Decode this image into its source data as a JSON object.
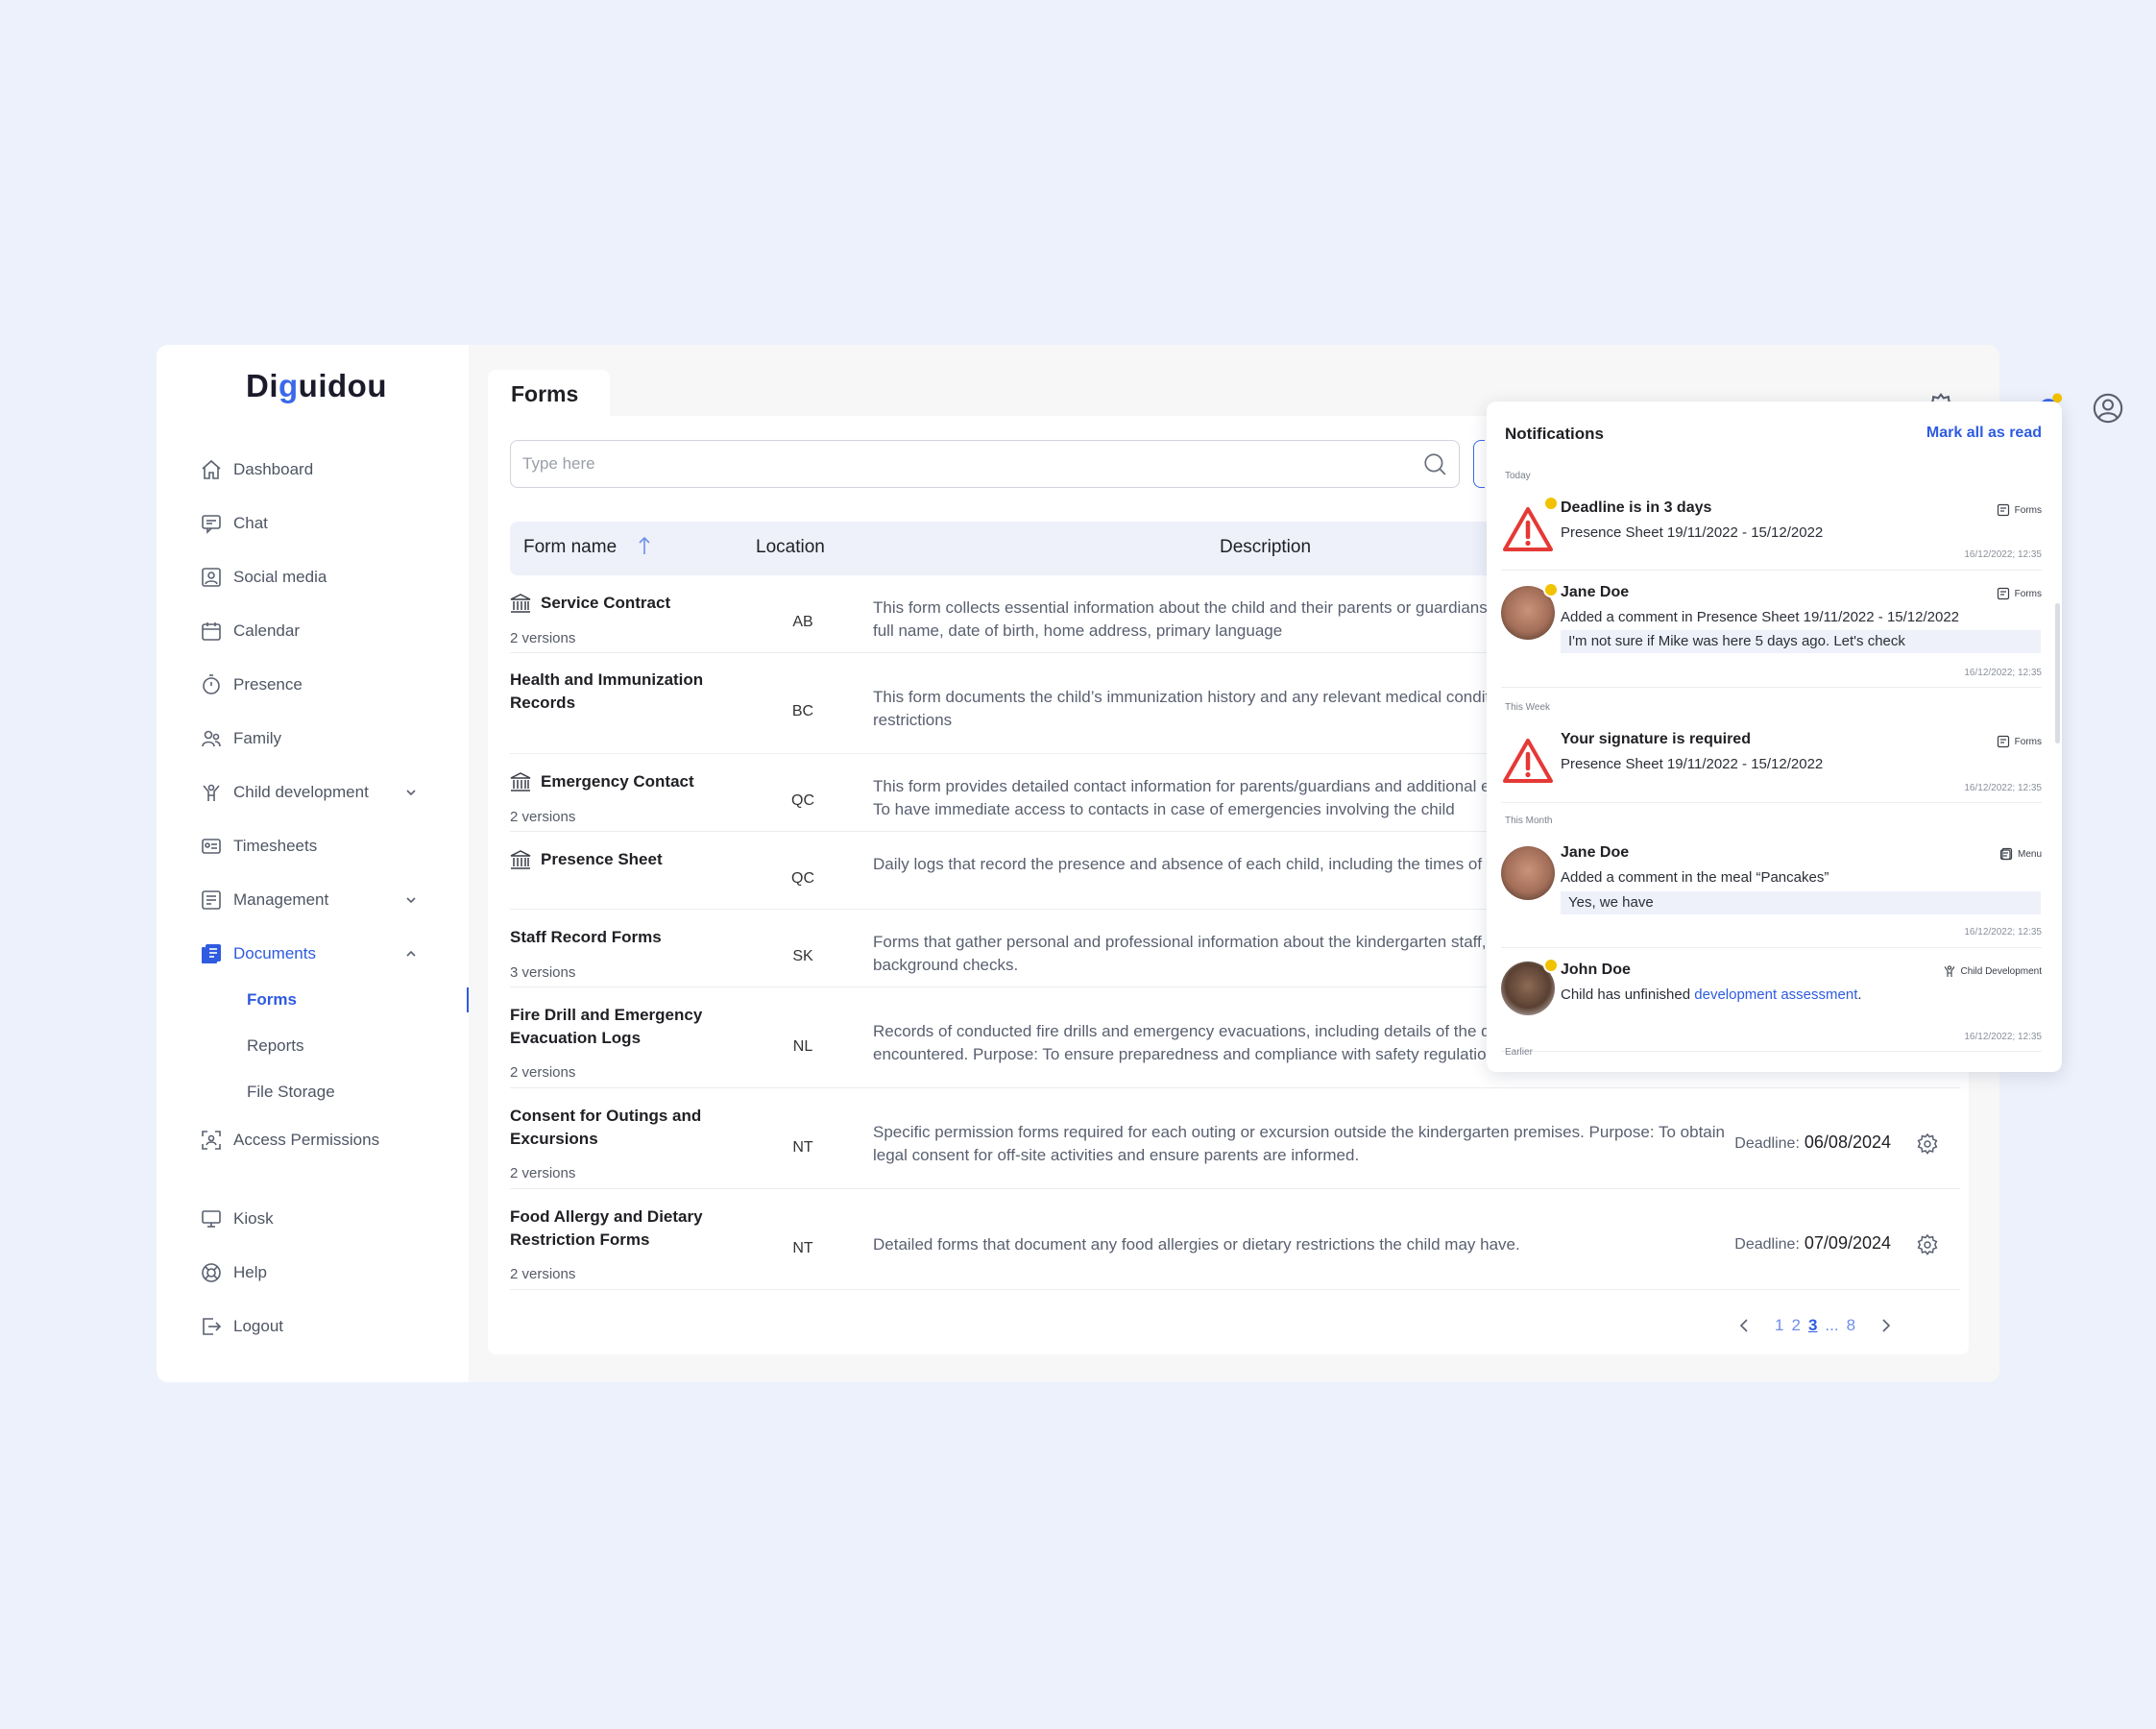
{
  "brand": {
    "logo_pre": "Di",
    "logo_g": "g",
    "logo_post": "uidou"
  },
  "sidebar": {
    "items": [
      {
        "label": "Dashboard"
      },
      {
        "label": "Chat"
      },
      {
        "label": "Social media"
      },
      {
        "label": "Calendar"
      },
      {
        "label": "Presence"
      },
      {
        "label": "Family"
      },
      {
        "label": "Child development"
      },
      {
        "label": "Timesheets"
      },
      {
        "label": "Management"
      },
      {
        "label": "Documents"
      },
      {
        "label": "Access Permissions"
      },
      {
        "label": "Kiosk"
      },
      {
        "label": "Help"
      },
      {
        "label": "Logout"
      }
    ],
    "documents_sub": [
      {
        "label": "Forms"
      },
      {
        "label": "Reports"
      },
      {
        "label": "File Storage"
      }
    ]
  },
  "page": {
    "title": "Forms"
  },
  "search": {
    "placeholder": "Type here"
  },
  "table": {
    "headers": {
      "name": "Form name",
      "location": "Location",
      "description": "Description"
    },
    "rows": [
      {
        "name": "Service Contract",
        "versions": "2 versions",
        "location": "AB",
        "description": "This form collects essential information about the child and their parents or guardians. It typically includes the child's full name, date of birth, home address, primary language",
        "deadline_label": "",
        "deadline": ""
      },
      {
        "name": "Health and Immunization Records",
        "versions": "",
        "location": "BC",
        "description": "This form documents the child’s immunization history and any relevant medical conditions, allergies or dietary restrictions",
        "deadline_label": "",
        "deadline": ""
      },
      {
        "name": "Emergency Contact",
        "versions": "2 versions",
        "location": "QC",
        "description": "This form provides detailed contact information for parents/guardians and additional emergency contacts. Purpose: To have immediate access to contacts in case of emergencies involving the child",
        "deadline_label": "",
        "deadline": ""
      },
      {
        "name": "Presence Sheet",
        "versions": "",
        "location": "QC",
        "description": "Daily logs that record the presence and absence of each child, including the times of arrival and leave",
        "deadline_label": "",
        "deadline": ""
      },
      {
        "name": "Staff Record Forms",
        "versions": "3 versions",
        "location": "SK",
        "description": "Forms that gather personal and professional information about the kindergarten staff, including qualifications and background checks.",
        "deadline_label": "",
        "deadline": ""
      },
      {
        "name": "Fire Drill and Emergency Evacuation Logs",
        "versions": "2 versions",
        "location": "NL",
        "description": "Records of conducted fire drills and emergency evacuations, including details of the drills and any issues encountered. Purpose: To ensure preparedness and compliance with safety regulations.",
        "deadline_label": "",
        "deadline": ""
      },
      {
        "name": "Consent for Outings and Excursions",
        "versions": "2 versions",
        "location": "NT",
        "description": "Specific permission forms required for each outing or excursion outside the kindergarten premises. Purpose: To obtain legal consent for off-site activities and ensure parents are informed.",
        "deadline_label": "Deadline:",
        "deadline": "06/08/2024"
      },
      {
        "name": "Food Allergy and Dietary Restriction Forms",
        "versions": "2 versions",
        "location": "NT",
        "description": "Detailed forms that document any food allergies or dietary restrictions the child may have.",
        "deadline_label": "Deadline:",
        "deadline": "07/09/2024"
      }
    ]
  },
  "pagination": {
    "pages": [
      "1",
      "2",
      "3",
      "...",
      "8"
    ],
    "current": "3"
  },
  "notifications": {
    "title": "Notifications",
    "mark_all": "Mark all as read",
    "groups": {
      "today": "Today",
      "week": "This Week",
      "month": "This Month",
      "earlier": "Earlier"
    },
    "items": [
      {
        "title": "Deadline is in 3 days",
        "text": "Presence Sheet 19/11/2022 - 15/12/2022",
        "category": "Forms",
        "time": "16/12/2022; 12:35"
      },
      {
        "title": "Jane Doe",
        "text": "Added a comment  in Presence Sheet 19/11/2022 - 15/12/2022",
        "quote": "I'm not sure if Mike was here 5 days ago. Let's check",
        "category": "Forms",
        "time": "16/12/2022; 12:35"
      },
      {
        "title": "Your signature is required",
        "text": "Presence Sheet 19/11/2022 - 15/12/2022",
        "category": "Forms",
        "time": "16/12/2022; 12:35"
      },
      {
        "title": "Jane Doe",
        "text": "Added a comment  in the meal “Pancakes”",
        "quote": "Yes, we have",
        "category": "Menu",
        "time": "16/12/2022; 12:35"
      },
      {
        "title": "John Doe",
        "text_pre": "Child has unfinished ",
        "link": "development assessment",
        "text_post": ".",
        "category": "Child Development",
        "time": "16/12/2022; 12:35"
      }
    ]
  },
  "colors": {
    "accent": "#2E5BE0",
    "badge": "#F2C200",
    "alert": "#E53935",
    "background": "#EDF1FB"
  },
  "icons": [
    "home-icon",
    "chat-icon",
    "social-media-icon",
    "calendar-icon",
    "stopwatch-icon",
    "family-icon",
    "child-development-icon",
    "timesheet-icon",
    "management-icon",
    "documents-icon",
    "access-permissions-icon",
    "kiosk-icon",
    "help-icon",
    "logout-icon",
    "settings-icon",
    "bell-icon",
    "user-icon",
    "search-icon",
    "building-icon",
    "gear-icon",
    "warning-icon"
  ]
}
